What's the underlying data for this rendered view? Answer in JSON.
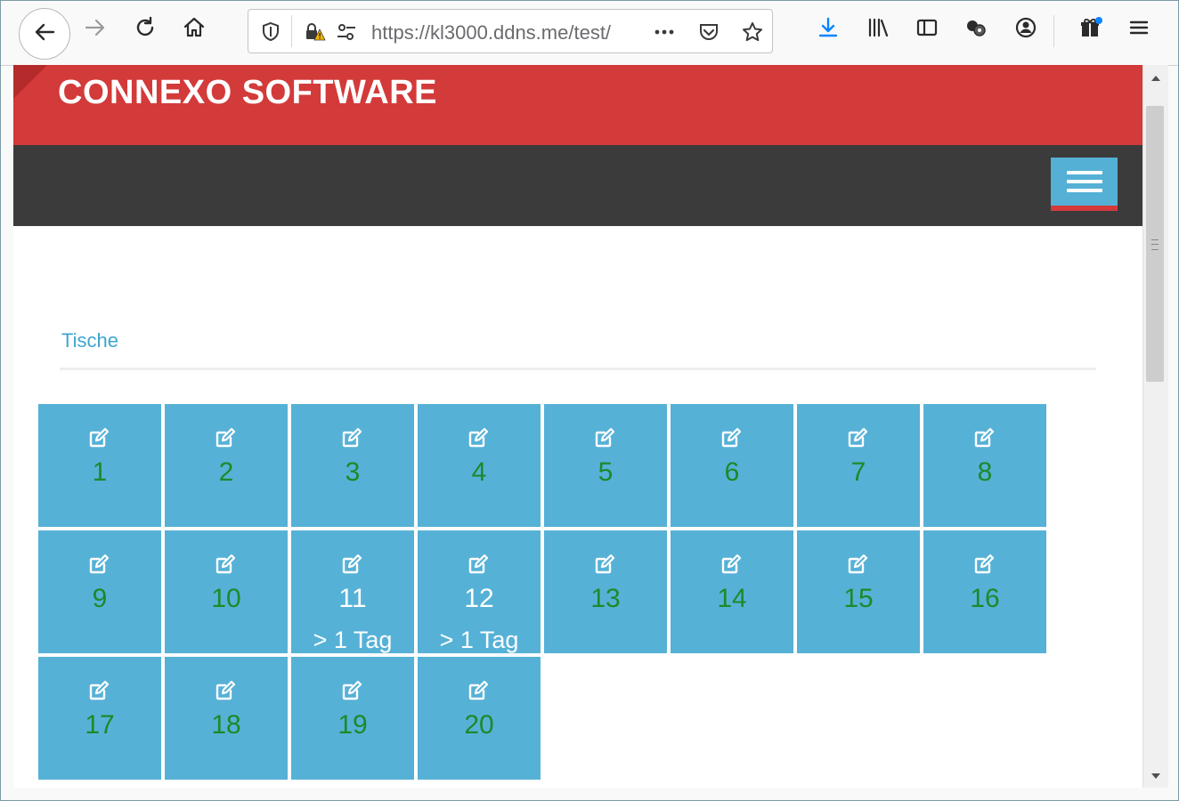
{
  "browser": {
    "url": "https://kl3000.ddns.me/test/",
    "icons": {
      "back": "back-arrow-icon",
      "forward": "forward-arrow-icon",
      "reload": "reload-icon",
      "home": "home-icon",
      "tracking": "shield-icon",
      "lock_warning": "lock-warning-icon",
      "permissions": "permissions-icon",
      "page_actions": "more-icon",
      "pocket": "pocket-icon",
      "bookmark": "star-icon",
      "downloads": "download-icon",
      "library": "library-icon",
      "sidebar": "sidebar-icon",
      "extensions": "extensions-icon",
      "account": "account-icon",
      "whats_new": "gift-icon",
      "menu": "hamburger-menu-icon"
    }
  },
  "page": {
    "brand_title": "CONNEXO SOFTWARE",
    "section_title": "Tische",
    "nav_menu_icon": "hamburger-menu-icon",
    "tile_icon": "edit-icon",
    "colors": {
      "brand_red": "#d33a3a",
      "nav_dark": "#3b3b3b",
      "tile_blue": "#56b1d6",
      "number_green": "#1b8a2a",
      "section_blue": "#3ea5cf"
    },
    "tables": [
      {
        "number": "1",
        "note": ""
      },
      {
        "number": "2",
        "note": ""
      },
      {
        "number": "3",
        "note": ""
      },
      {
        "number": "4",
        "note": ""
      },
      {
        "number": "5",
        "note": ""
      },
      {
        "number": "6",
        "note": ""
      },
      {
        "number": "7",
        "note": ""
      },
      {
        "number": "8",
        "note": ""
      },
      {
        "number": "9",
        "note": ""
      },
      {
        "number": "10",
        "note": ""
      },
      {
        "number": "11",
        "note": "> 1 Tag"
      },
      {
        "number": "12",
        "note": "> 1 Tag"
      },
      {
        "number": "13",
        "note": ""
      },
      {
        "number": "14",
        "note": ""
      },
      {
        "number": "15",
        "note": ""
      },
      {
        "number": "16",
        "note": ""
      },
      {
        "number": "17",
        "note": ""
      },
      {
        "number": "18",
        "note": ""
      },
      {
        "number": "19",
        "note": ""
      },
      {
        "number": "20",
        "note": ""
      }
    ]
  }
}
